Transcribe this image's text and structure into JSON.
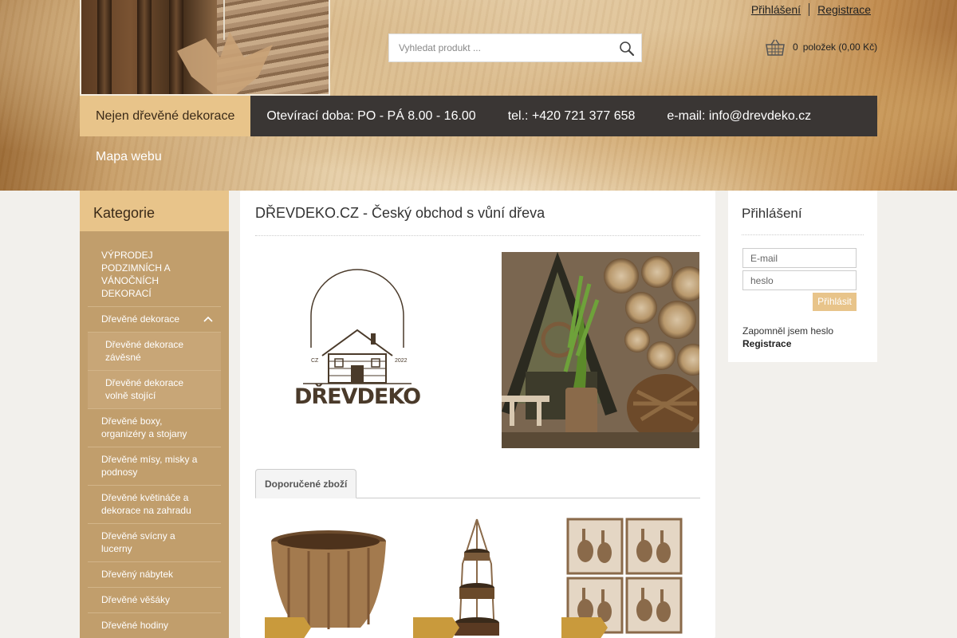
{
  "header": {
    "login_link": "Přihlášení",
    "register_link": "Registrace",
    "search_placeholder": "Vyhledat produkt ...",
    "cart": {
      "count": "0",
      "label": "položek (0,00 Kč)"
    }
  },
  "nav": {
    "items": [
      "Nejen dřevěné dekorace",
      "Otevírací doba: PO - PÁ 8.00 - 16.00",
      "tel.: +420 721 377 658",
      "e-mail: info@drevdeko.cz"
    ],
    "second_row": "Mapa webu"
  },
  "sidebar": {
    "title": "Kategorie",
    "items": [
      "VÝPRODEJ PODZIMNÍCH A VÁNOČNÍCH DEKORACÍ",
      "Dřevěné dekorace",
      "Dřevěné dekorace závěsné",
      "Dřevěné dekorace volně stojící",
      "Dřevěné boxy, organizéry a stojany",
      "Dřevěné mísy, misky a podnosy",
      "Dřevěné květináče a dekorace na zahradu",
      "Dřevěné svícny a lucerny",
      "Dřevěný nábytek",
      "Dřevěné věšáky",
      "Dřevěné hodiny"
    ]
  },
  "main": {
    "title": "DŘEVDEKO.CZ - Český obchod s vůní dřeva",
    "logo": {
      "text": "DŘEVDEKO",
      "cz": "CZ",
      "year": "2022"
    },
    "tab": "Doporučené zboží"
  },
  "login": {
    "title": "Přihlášení",
    "email_placeholder": "E-mail",
    "password_placeholder": "heslo",
    "submit": "Přihlásit",
    "forgot": "Zapomněl jsem heslo",
    "register": "Registrace"
  },
  "colors": {
    "accent": "#e8c48a",
    "nav_bg": "#3a3634",
    "sidebar_bg": "#c19e6c"
  }
}
